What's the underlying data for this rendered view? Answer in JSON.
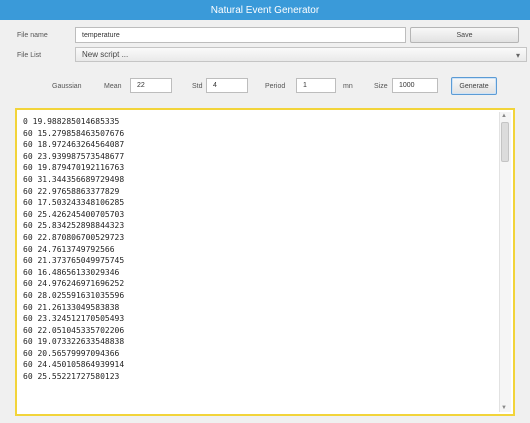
{
  "window": {
    "title": "Natural Event Generator"
  },
  "form": {
    "file_name_label": "File name",
    "file_name_value": "temperature",
    "save_label": "Save",
    "file_list_label": "File List",
    "file_list_value": "New script ...",
    "gaussian_label": "Gaussian",
    "mean_label": "Mean",
    "mean_value": "22",
    "std_label": "Std",
    "std_value": "4",
    "period_label": "Period",
    "period_value": "1",
    "period_unit": "mn",
    "size_label": "Size",
    "size_value": "1000",
    "generate_label": "Generate"
  },
  "output": {
    "lines": [
      "0 19.988285014685335",
      "60 15.279858463507676",
      "60 18.972463264564087",
      "60 23.939987573548677",
      "60 19.879470192116763",
      "60 31.344356689729498",
      "60 22.97658863377829",
      "60 17.503243348106285",
      "60 25.426245400705703",
      "60 25.834252898844323",
      "60 22.870806700529723",
      "60 24.7613749792566",
      "60 21.373765049975745",
      "60 16.48656133029346",
      "60 24.976246971696252",
      "60 28.025591631035596",
      "60 21.26133049583838",
      "60 23.324512170505493",
      "60 22.051045335702206",
      "60 19.073322633548838",
      "60 20.56579997094366",
      "60 24.450105864939914",
      "60 25.55221727580123"
    ]
  }
}
